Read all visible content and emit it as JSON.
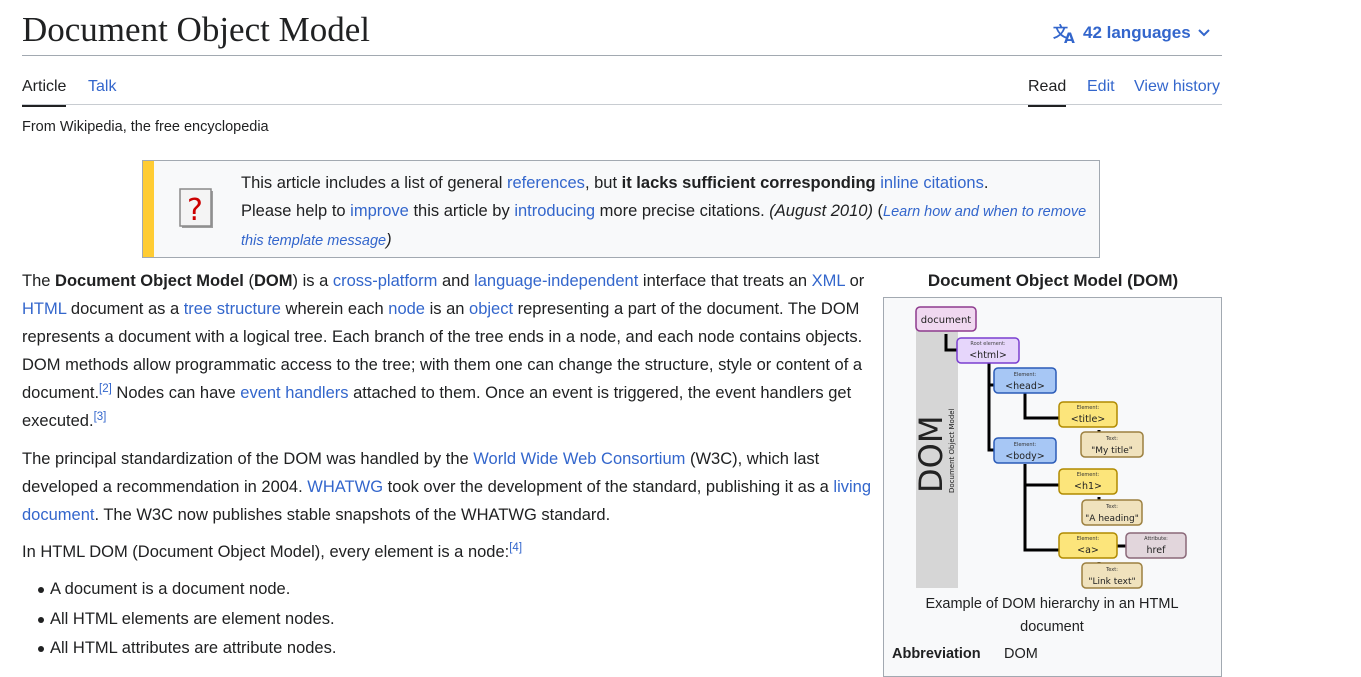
{
  "header": {
    "title": "Document Object Model",
    "languages_label": "42 languages"
  },
  "tabs": {
    "left": [
      {
        "label": "Article",
        "active": true
      },
      {
        "label": "Talk",
        "active": false
      }
    ],
    "right": [
      {
        "label": "Read",
        "active": true
      },
      {
        "label": "Edit",
        "active": false
      },
      {
        "label": "View history",
        "active": false
      }
    ]
  },
  "tagline": "From Wikipedia, the free encyclopedia",
  "notice": {
    "l1_a": "This article includes a list of general ",
    "l1_link1": "references",
    "l1_b": ", but ",
    "l1_bold": "it lacks sufficient corresponding ",
    "l1_link2": "inline citations",
    "l1_c": ".",
    "l2_a": "Please help to ",
    "l2_link1": "improve",
    "l2_b": " this article by ",
    "l2_link2": "introducing",
    "l2_c": " more precise citations. ",
    "l2_date": "(August 2010)",
    "l2_d": " (",
    "l2_link3": "Learn how and when to remove this template message",
    "l2_e": ")"
  },
  "para1": {
    "t1": "The ",
    "b1": "Document Object Model",
    "t2": " (",
    "b2": "DOM",
    "t3": ") is a ",
    "link_crossplatform": "cross-platform",
    "t4": " and ",
    "link_langindep": "language-independent",
    "t5": " interface that treats an ",
    "link_xml": "XML",
    "t6": " or ",
    "link_html": "HTML",
    "t7": " document as a ",
    "link_tree": "tree structure",
    "t8": " wherein each ",
    "link_node": "node",
    "t9": " is an ",
    "link_object": "object",
    "t10": " representing a part of the document. The DOM represents a document with a logical tree. Each branch of the tree ends in a node, and each node contains objects. DOM methods allow programmatic access to the tree; with them one can change the structure, style or content of a document.",
    "ref2": "[2]",
    "t11": " Nodes can have ",
    "link_events": "event handlers",
    "t12": " attached to them. Once an event is triggered, the event handlers get executed.",
    "ref3": "[3]"
  },
  "para2": {
    "t1": "The principal standardization of the DOM was handled by the ",
    "link_w3c": "World Wide Web Consortium",
    "t2": " (W3C), which last developed a recommendation in 2004. ",
    "link_whatwg": "WHATWG",
    "t3": " took over the development of the standard, publishing it as a ",
    "link_living": "living document",
    "t4": ". The W3C now publishes stable snapshots of the WHATWG standard."
  },
  "para3": {
    "t1": "In HTML DOM (Document Object Model), every element is a node:",
    "ref4": "[4]"
  },
  "bullets": [
    "A document is a document node.",
    "All HTML elements are element nodes.",
    "All HTML attributes are attribute nodes."
  ],
  "infobox": {
    "title": "Document Object Model (DOM)",
    "caption": "Example of DOM hierarchy in an HTML document",
    "abbr_label": "Abbreviation",
    "abbr_value": "DOM",
    "diagram": {
      "side_big": "DOM",
      "side_small": "Document Object Model",
      "document": "document",
      "root_label": "Root element:",
      "html": "<html>",
      "element_label": "Element:",
      "text_label": "Text:",
      "attribute_label": "Attribute:",
      "head": "<head>",
      "title": "<title>",
      "title_text": "\"My title\"",
      "body": "<body>",
      "h1": "<h1>",
      "h1_text": "\"A heading\"",
      "a": "<a>",
      "href": "href",
      "a_text": "\"Link text\""
    }
  },
  "colors": {
    "link": "#3366cc",
    "text": "#202122",
    "notice_bar": "#ffcc33",
    "doc_box": "#f0d8f0",
    "html_box": "#e6d6fb",
    "element_box": "#a7c7f5",
    "title_box": "#fce57b",
    "text_box": "#f0e2bd",
    "attr_box": "#e2d6dc"
  },
  "icons": {
    "language": "translate-icon",
    "chevron": "chevron-down-icon",
    "notice": "question-mark-book-icon"
  }
}
